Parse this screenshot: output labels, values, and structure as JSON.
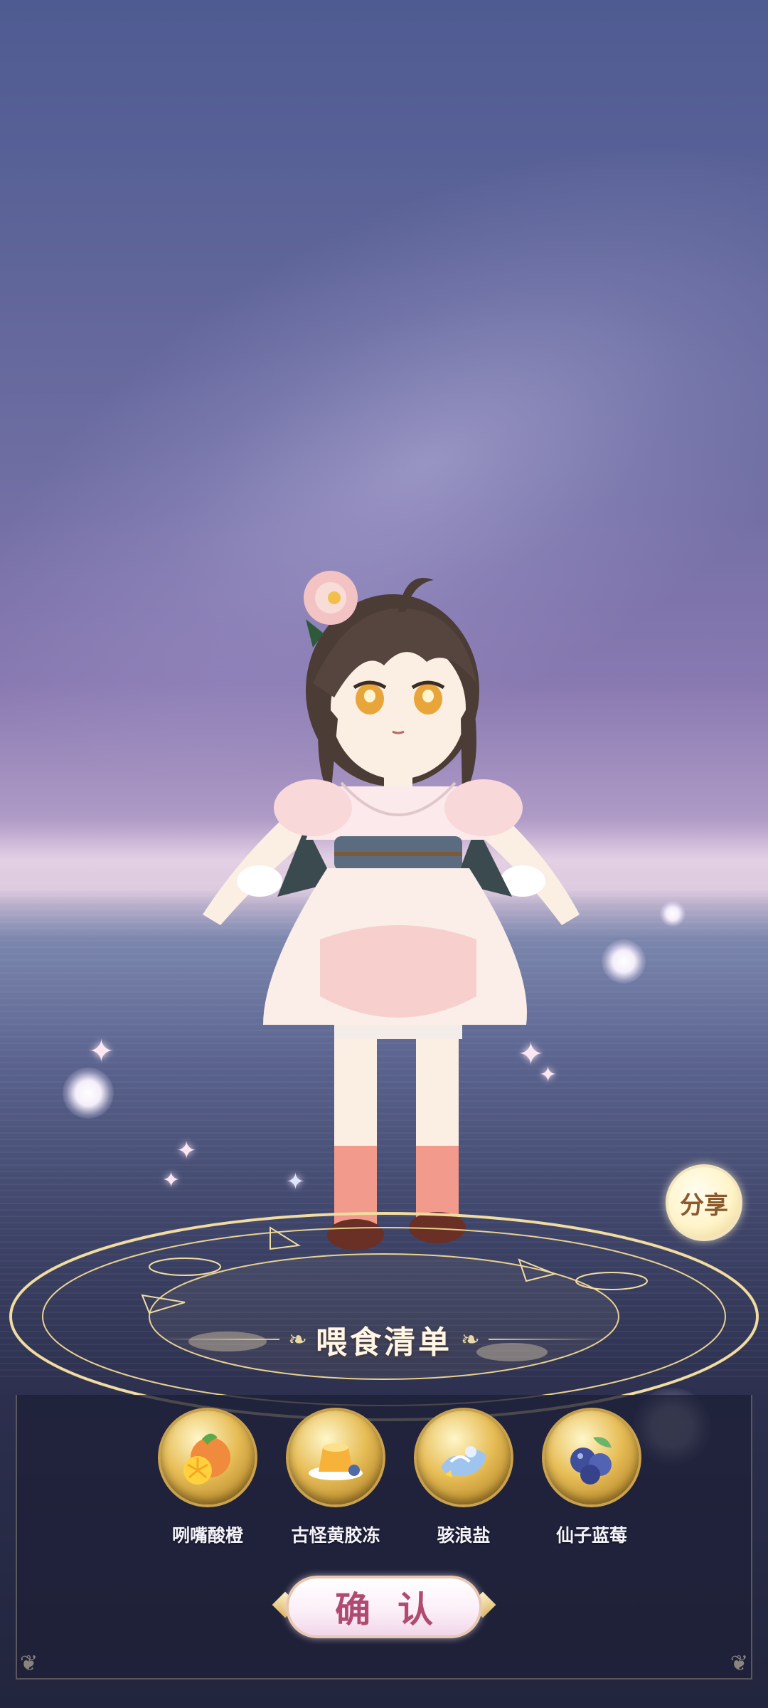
{
  "share": {
    "label": "分享",
    "icon": "share-icon"
  },
  "feeding_list": {
    "title": "喂食清单",
    "items": [
      {
        "label": "咧嘴酸橙",
        "icon": "orange-icon"
      },
      {
        "label": "古怪黄胶冻",
        "icon": "pudding-icon"
      },
      {
        "label": "骇浪盐",
        "icon": "wave-salt-icon"
      },
      {
        "label": "仙子蓝莓",
        "icon": "blueberry-icon"
      }
    ]
  },
  "confirm": {
    "label": "确认"
  },
  "colors": {
    "accent_gold": "#e7bd57",
    "confirm_text": "#b04a6e",
    "panel_bg": "#1e2037"
  }
}
